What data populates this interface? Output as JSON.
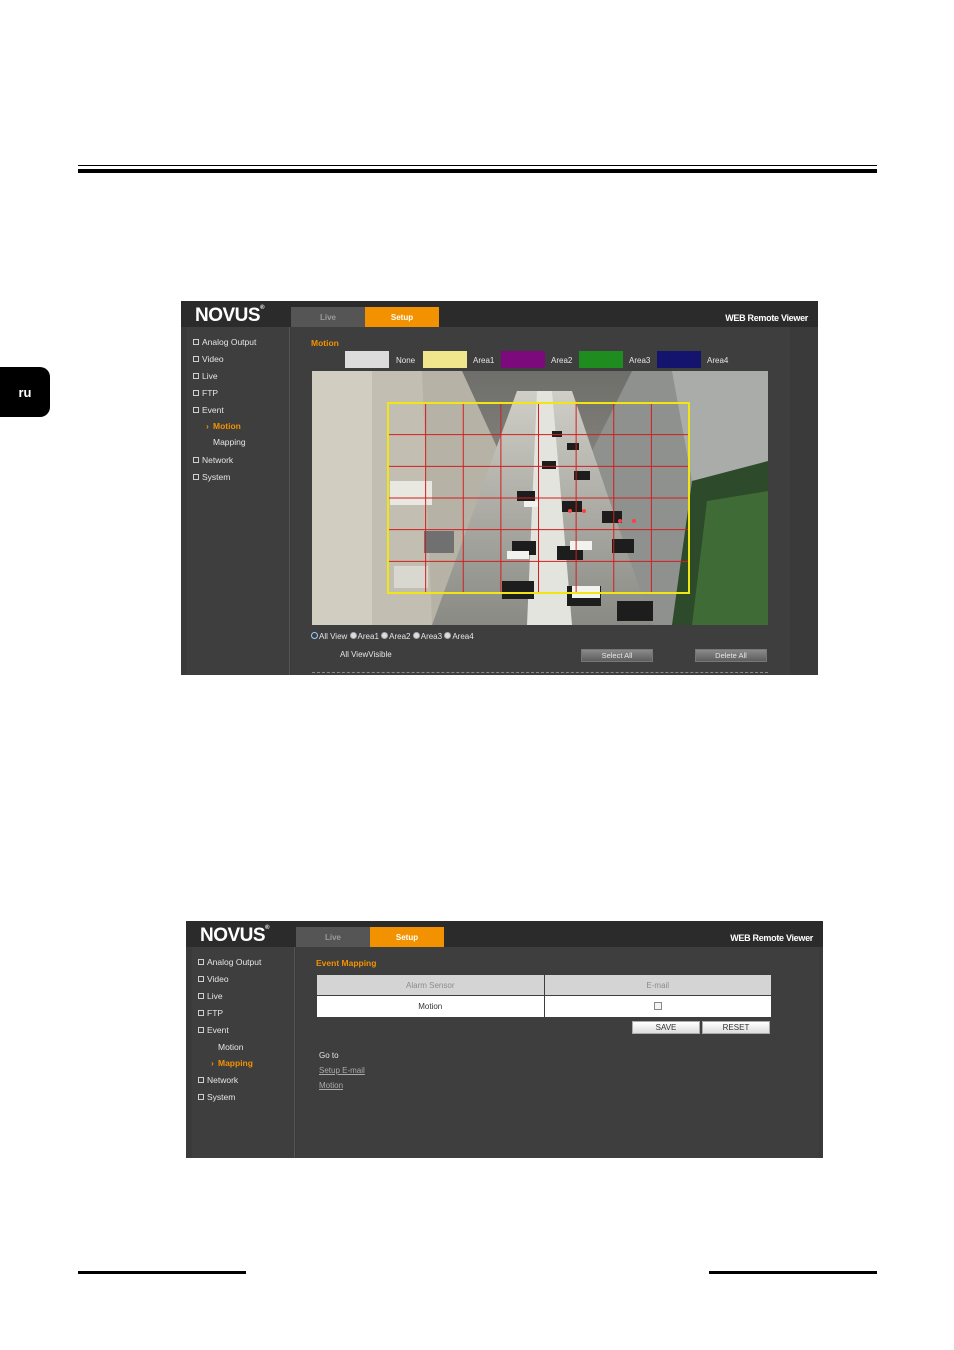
{
  "page": {
    "lang_tab": "ru"
  },
  "shot1": {
    "logo": "NOVUS",
    "logo_reg": "®",
    "tabs": [
      "Live",
      "Setup"
    ],
    "brand": "WEB Remote Viewer",
    "sidebar": [
      "Analog Output",
      "Video",
      "Live",
      "FTP",
      "Event",
      "Motion",
      "Mapping",
      "Network",
      "System"
    ],
    "active_item": "Motion",
    "section_title": "Motion",
    "areas": [
      {
        "label": "None",
        "color": "#dcdcdc"
      },
      {
        "label": "Area1",
        "color": "#f0e68c"
      },
      {
        "label": "Area2",
        "color": "#7d0a7d"
      },
      {
        "label": "Area3",
        "color": "#1e8c1e"
      },
      {
        "label": "Area4",
        "color": "#14146e"
      }
    ],
    "grid_color": "#d21e1e",
    "selection_color": "#f0e614",
    "view_options": [
      "All View",
      "Area1",
      "Area2",
      "Area3",
      "Area4"
    ],
    "selected_view": "All View",
    "visible_label": "All ViewVisible",
    "buttons": [
      "Select All",
      "Delete All"
    ]
  },
  "shot2": {
    "logo": "NOVUS",
    "logo_reg": "®",
    "tabs": [
      "Live",
      "Setup"
    ],
    "brand": "WEB Remote Viewer",
    "sidebar": [
      "Analog Output",
      "Video",
      "Live",
      "FTP",
      "Event",
      "Motion",
      "Mapping",
      "Network",
      "System"
    ],
    "active_item": "Mapping",
    "section_title": "Event Mapping",
    "table": {
      "headers": [
        "Alarm Sensor",
        "E-mail"
      ],
      "rows": [
        {
          "sensor": "Motion",
          "email_checked": false
        }
      ]
    },
    "buttons": [
      "SAVE",
      "RESET"
    ],
    "goto_label": "Go to",
    "links": [
      "Setup E-mail",
      "Motion"
    ]
  }
}
